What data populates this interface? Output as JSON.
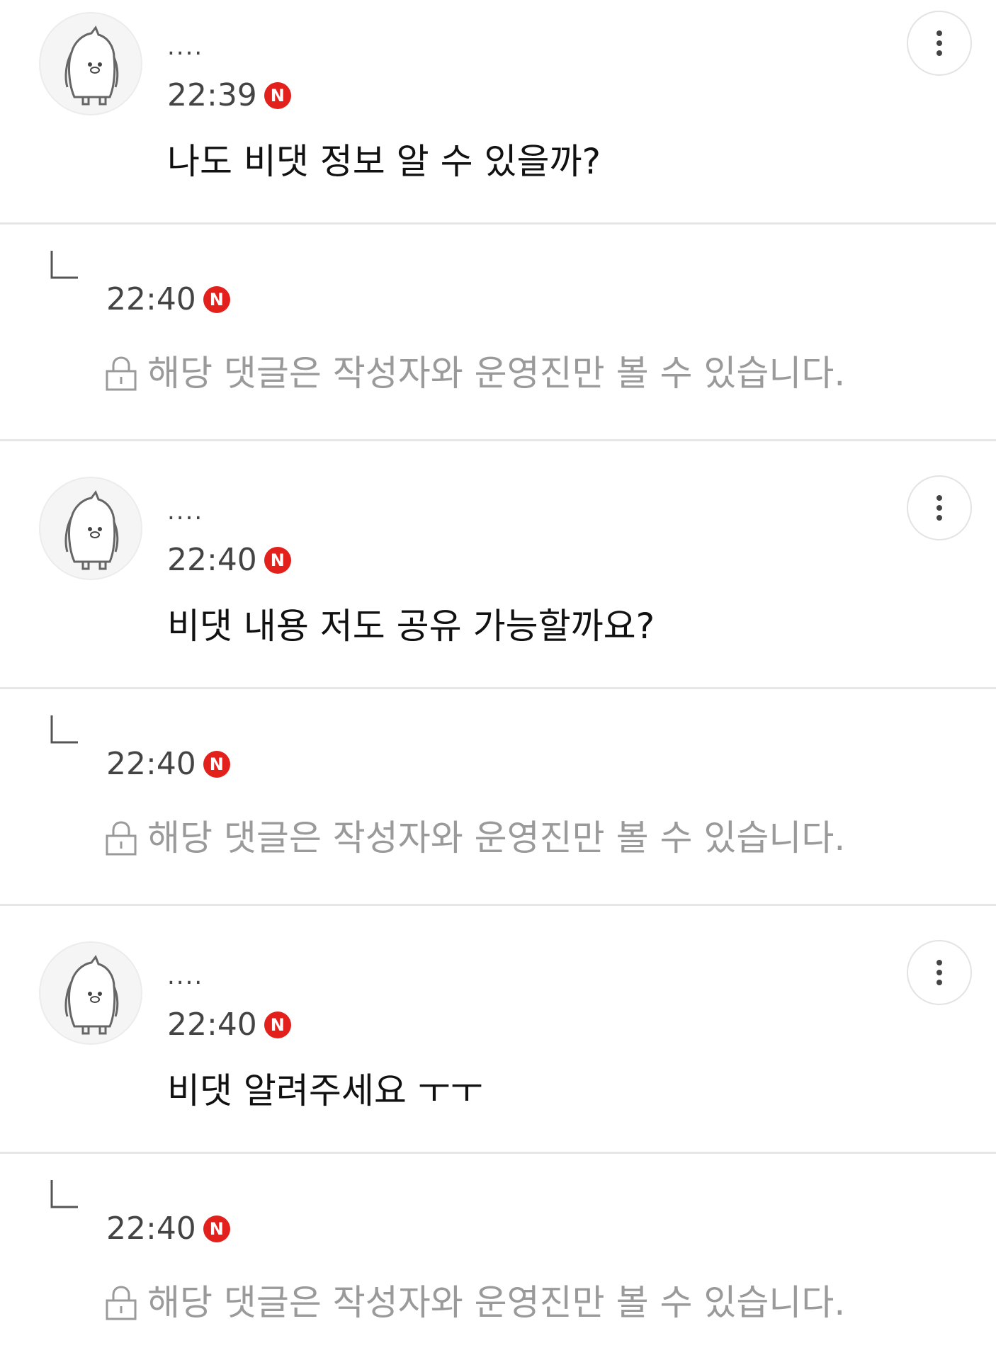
{
  "accent_color": "#e2211c",
  "comments": [
    {
      "nickname": "....",
      "time": "22:39",
      "badge": "N",
      "text": "나도 비댓 정보 알 수 있을까?",
      "reply": {
        "time": "22:40",
        "badge": "N",
        "secret_text": "해당 댓글은 작성자와 운영진만 볼 수 있습니다."
      }
    },
    {
      "nickname": "....",
      "time": "22:40",
      "badge": "N",
      "text": "비댓 내용 저도 공유 가능할까요?",
      "reply": {
        "time": "22:40",
        "badge": "N",
        "secret_text": "해당 댓글은 작성자와 운영진만 볼 수 있습니다."
      }
    },
    {
      "nickname": "....",
      "time": "22:40",
      "badge": "N",
      "text": "비댓 알려주세요 ㅜㅜ",
      "reply": {
        "time": "22:40",
        "badge": "N",
        "secret_text": "해당 댓글은 작성자와 운영진만 볼 수 있습니다."
      }
    }
  ],
  "icons": {
    "avatar": "penguin-avatar-icon",
    "more": "more-vertical-icon",
    "reply": "reply-arrow-icon",
    "lock": "lock-icon"
  }
}
